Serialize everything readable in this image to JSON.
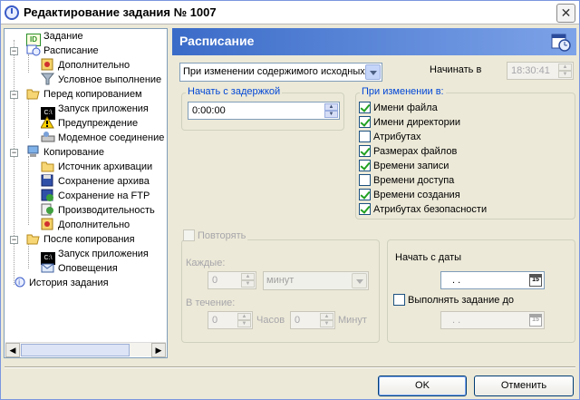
{
  "window": {
    "title": "Редактирование задания № 1007",
    "close_label": "✕"
  },
  "tree": {
    "items": [
      {
        "label": "Задание",
        "icon": "task-id-icon"
      },
      {
        "label": "Расписание",
        "icon": "schedule-icon"
      },
      {
        "label": "Дополнительно",
        "icon": "advanced-icon"
      },
      {
        "label": "Условное выполнение",
        "icon": "filter-icon"
      },
      {
        "label": "Перед копированием",
        "icon": "folder-open-icon"
      },
      {
        "label": "Запуск приложения",
        "icon": "console-icon"
      },
      {
        "label": "Предупреждение",
        "icon": "warning-icon"
      },
      {
        "label": "Модемное соединение",
        "icon": "modem-icon"
      },
      {
        "label": "Копирование",
        "icon": "computer-icon"
      },
      {
        "label": "Источник архивации",
        "icon": "folder-icon"
      },
      {
        "label": "Сохранение архива",
        "icon": "floppy-icon"
      },
      {
        "label": "Сохранение на FTP",
        "icon": "ftp-icon"
      },
      {
        "label": "Производительность",
        "icon": "performance-icon"
      },
      {
        "label": "Дополнительно",
        "icon": "advanced-icon"
      },
      {
        "label": "После копирования",
        "icon": "folder-open-icon"
      },
      {
        "label": "Запуск приложения",
        "icon": "console-icon"
      },
      {
        "label": "Оповещения",
        "icon": "mail-icon"
      },
      {
        "label": "История задания",
        "icon": "history-icon"
      }
    ]
  },
  "header": {
    "title": "Расписание",
    "icon": "schedule-clock-icon"
  },
  "trigger": {
    "selected": "При изменении содержимого исходных"
  },
  "start_at": {
    "label": "Начинать в",
    "value": "18:30:41"
  },
  "delay": {
    "group_label": "Начать с задержкой",
    "value": "0:00:00"
  },
  "on_change": {
    "group_label": "При изменении в:",
    "options": [
      {
        "label": "Имени файла",
        "checked": true
      },
      {
        "label": "Имени директории",
        "checked": true
      },
      {
        "label": "Атрибутах",
        "checked": false
      },
      {
        "label": "Размерах файлов",
        "checked": true
      },
      {
        "label": "Времени записи",
        "checked": true
      },
      {
        "label": "Времени доступа",
        "checked": false
      },
      {
        "label": "Времени создания",
        "checked": true
      },
      {
        "label": "Атрибутах безопасности",
        "checked": true
      }
    ]
  },
  "repeat": {
    "label": "Повторять",
    "every_label": "Каждые:",
    "every_value": "0",
    "every_unit": "минут",
    "during_label": "В течение:",
    "hours_value": "0",
    "hours_label": "Часов",
    "minutes_value": "0",
    "minutes_label": "Минут"
  },
  "dates": {
    "start_label": "Начать с даты",
    "start_value": ". .",
    "until_label": "Выполнять задание до",
    "until_value": ". .",
    "cal_label": "15"
  },
  "buttons": {
    "ok": "OK",
    "cancel": "Отменить"
  }
}
